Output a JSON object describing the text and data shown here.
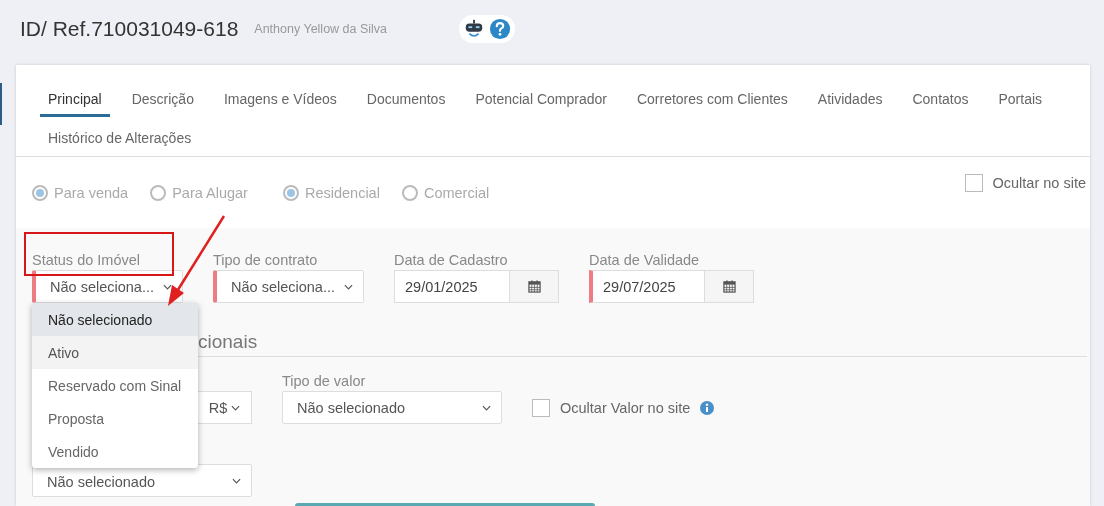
{
  "header": {
    "title": "ID/ Ref.710031049-618",
    "subtitle": "Anthony Yellow da Silva"
  },
  "tabs": [
    {
      "label": "Principal",
      "selected": true
    },
    {
      "label": "Descrição",
      "selected": false
    },
    {
      "label": "Imagens e Vídeos",
      "selected": false
    },
    {
      "label": "Documentos",
      "selected": false
    },
    {
      "label": "Potencial Comprador",
      "selected": false
    },
    {
      "label": "Corretores com Clientes",
      "selected": false
    },
    {
      "label": "Atividades",
      "selected": false
    },
    {
      "label": "Contatos",
      "selected": false
    },
    {
      "label": "Portais",
      "selected": false
    },
    {
      "label": "Histórico de Alterações",
      "selected": false
    }
  ],
  "radio_groups": [
    [
      {
        "label": "Para venda",
        "selected": true
      },
      {
        "label": "Para Alugar",
        "selected": false
      }
    ],
    [
      {
        "label": "Residencial",
        "selected": true
      },
      {
        "label": "Comercial",
        "selected": false
      }
    ]
  ],
  "hide_on_site": {
    "label": "Ocultar no site",
    "checked": false
  },
  "fields": [
    {
      "label": "Status do Imóvel",
      "kind": "select",
      "value": "Não seleciona...",
      "required": true
    },
    {
      "label": "Tipo de contrato",
      "kind": "select",
      "value": "Não seleciona...",
      "required": true
    },
    {
      "label": "Data de Cadastro",
      "kind": "date",
      "value": "29/01/2025",
      "required": false
    },
    {
      "label": "Data de Validade",
      "kind": "date",
      "value": "29/07/2025",
      "required": true
    }
  ],
  "section_title": "cionais",
  "currency": "R$",
  "value_type": {
    "label": "Tipo de valor",
    "value": "Não selecionado"
  },
  "hide_value": {
    "label": "Ocultar Valor no site",
    "checked": false
  },
  "bottom_select": {
    "value": "Não selecionado"
  },
  "dropdown": [
    {
      "label": "Não selecionado",
      "selected": true,
      "highlighted": false
    },
    {
      "label": "Ativo",
      "selected": false,
      "highlighted": true
    },
    {
      "label": "Reservado com Sinal",
      "selected": false,
      "highlighted": false
    },
    {
      "label": "Proposta",
      "selected": false,
      "highlighted": false
    },
    {
      "label": "Vendido",
      "selected": false,
      "highlighted": false
    }
  ]
}
